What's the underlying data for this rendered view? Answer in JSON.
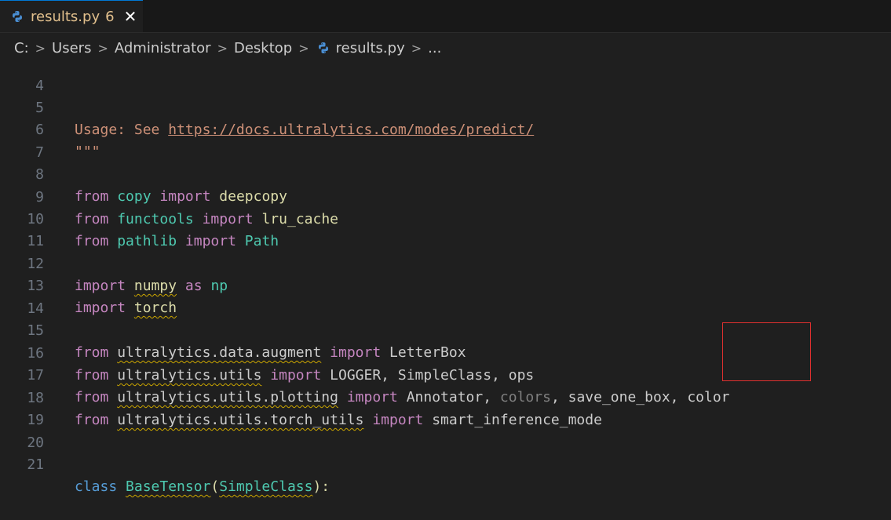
{
  "tab": {
    "name": "results.py",
    "problems": "6",
    "close": "✕"
  },
  "breadcrumb": {
    "items": [
      "C:",
      "Users",
      "Administrator",
      "Desktop",
      "results.py",
      "..."
    ]
  },
  "editor": {
    "lines": {
      "l4": {
        "num": "4"
      },
      "l5": {
        "num": "5",
        "prefix": "Usage: See ",
        "url": "https://docs.ultralytics.com/modes/predict/"
      },
      "l6": {
        "num": "6",
        "text": "\"\"\""
      },
      "l7": {
        "num": "7"
      },
      "l8": {
        "num": "8",
        "t1": "from",
        "t2": "copy",
        "t3": "import",
        "t4": "deepcopy"
      },
      "l9": {
        "num": "9",
        "t1": "from",
        "t2": "functools",
        "t3": "import",
        "t4": "lru_cache"
      },
      "l10": {
        "num": "10",
        "t1": "from",
        "t2": "pathlib",
        "t3": "import",
        "t4": "Path"
      },
      "l11": {
        "num": "11"
      },
      "l12": {
        "num": "12",
        "t1": "import",
        "t2": "numpy",
        "t3": "as",
        "t4": "np"
      },
      "l13": {
        "num": "13",
        "t1": "import",
        "t2": "torch"
      },
      "l14": {
        "num": "14"
      },
      "l15": {
        "num": "15",
        "t1": "from",
        "t2": "ultralytics.data.augment",
        "t3": "import",
        "t4": "LetterBox"
      },
      "l16": {
        "num": "16",
        "t1": "from",
        "t2": "ultralytics.utils",
        "t3": "import",
        "t4": "LOGGER, SimpleClass, ops"
      },
      "l17": {
        "num": "17",
        "t1": "from",
        "t2": "ultralytics.utils.plotting",
        "t3": "import",
        "t4": "Annotator, ",
        "t5": "colors",
        "t6": ", save_one_box, ",
        "t7": "color"
      },
      "l18": {
        "num": "18",
        "t1": "from",
        "t2": "ultralytics.utils.torch_utils",
        "t3": "import",
        "t4": "smart_inference_mode"
      },
      "l19": {
        "num": "19"
      },
      "l20": {
        "num": "20"
      },
      "l21": {
        "num": "21",
        "t1": "class",
        "t2": "BaseTensor",
        "t3": "(",
        "t4": "SimpleClass",
        "t5": "):"
      }
    }
  },
  "colors": {
    "highlight_box": "#e0302f",
    "tab_text": "#e2c08d",
    "squiggle": "#cca700"
  }
}
